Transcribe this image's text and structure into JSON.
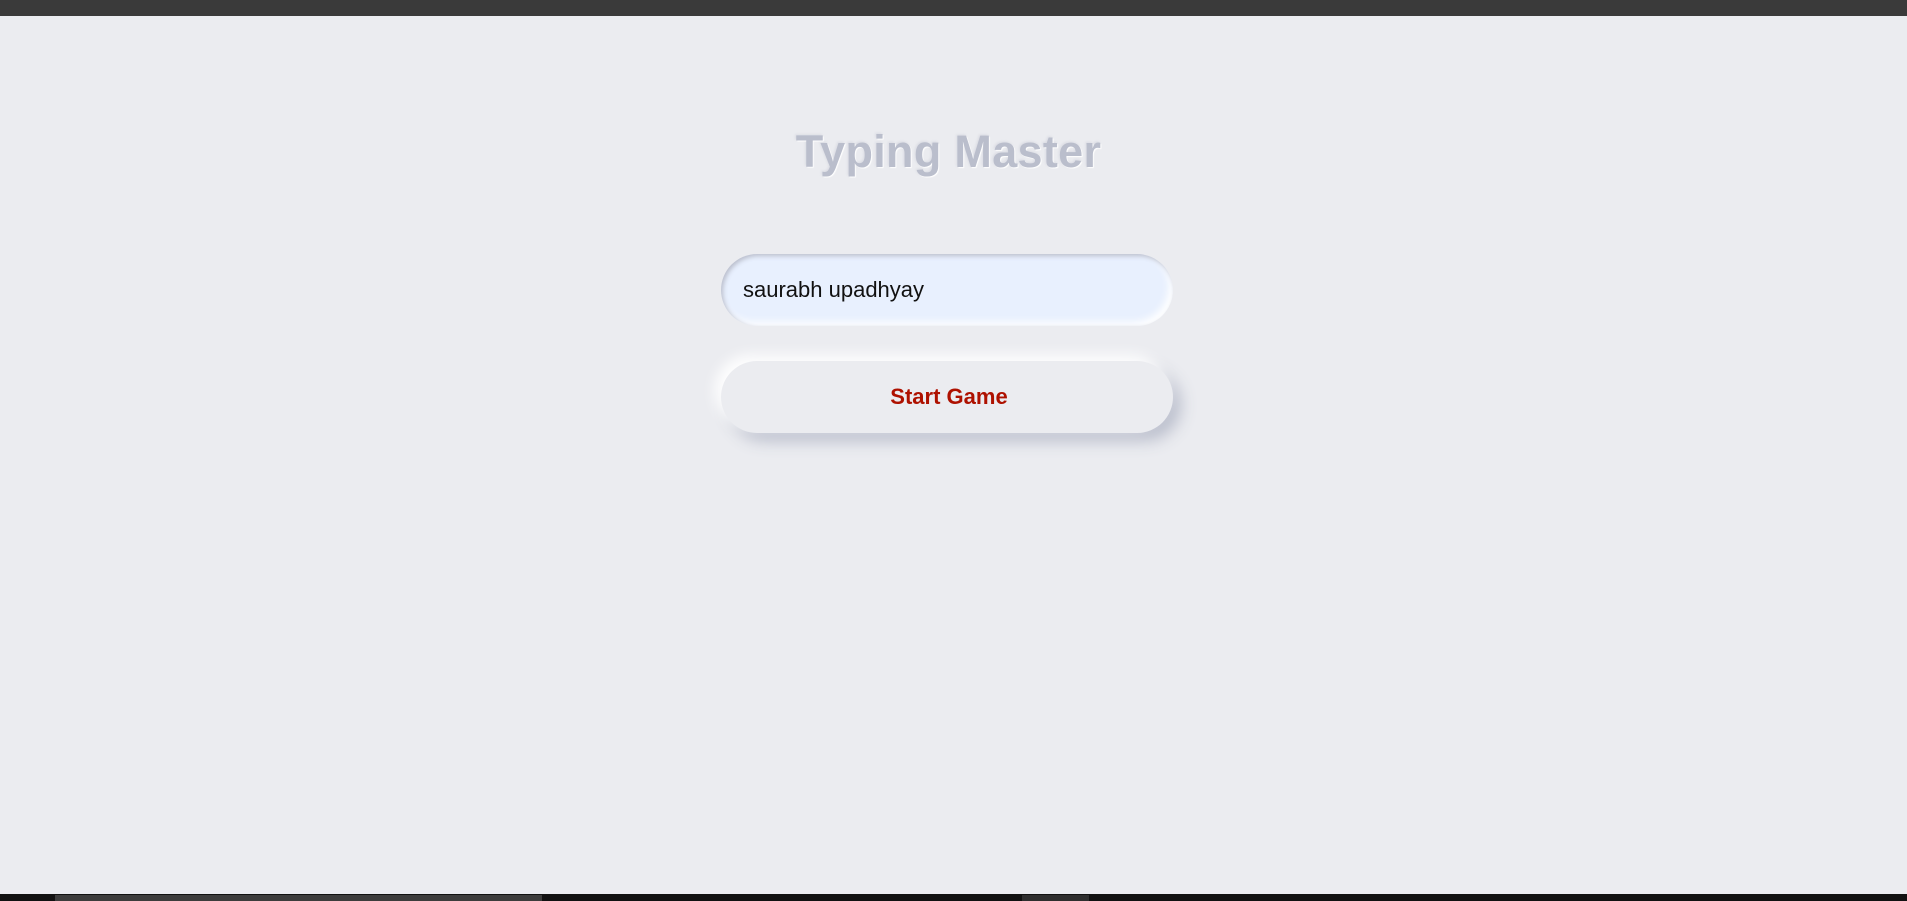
{
  "app": {
    "title": "Typing Master"
  },
  "name_field": {
    "value": "saurabh upadhyay",
    "placeholder": ""
  },
  "start_button": {
    "label": "Start Game"
  },
  "colors": {
    "background": "#ebecf0",
    "title": "#babecc",
    "input_background": "#e8f0fe",
    "button_text": "#ae1100",
    "top_bar": "#3a3a3a"
  }
}
